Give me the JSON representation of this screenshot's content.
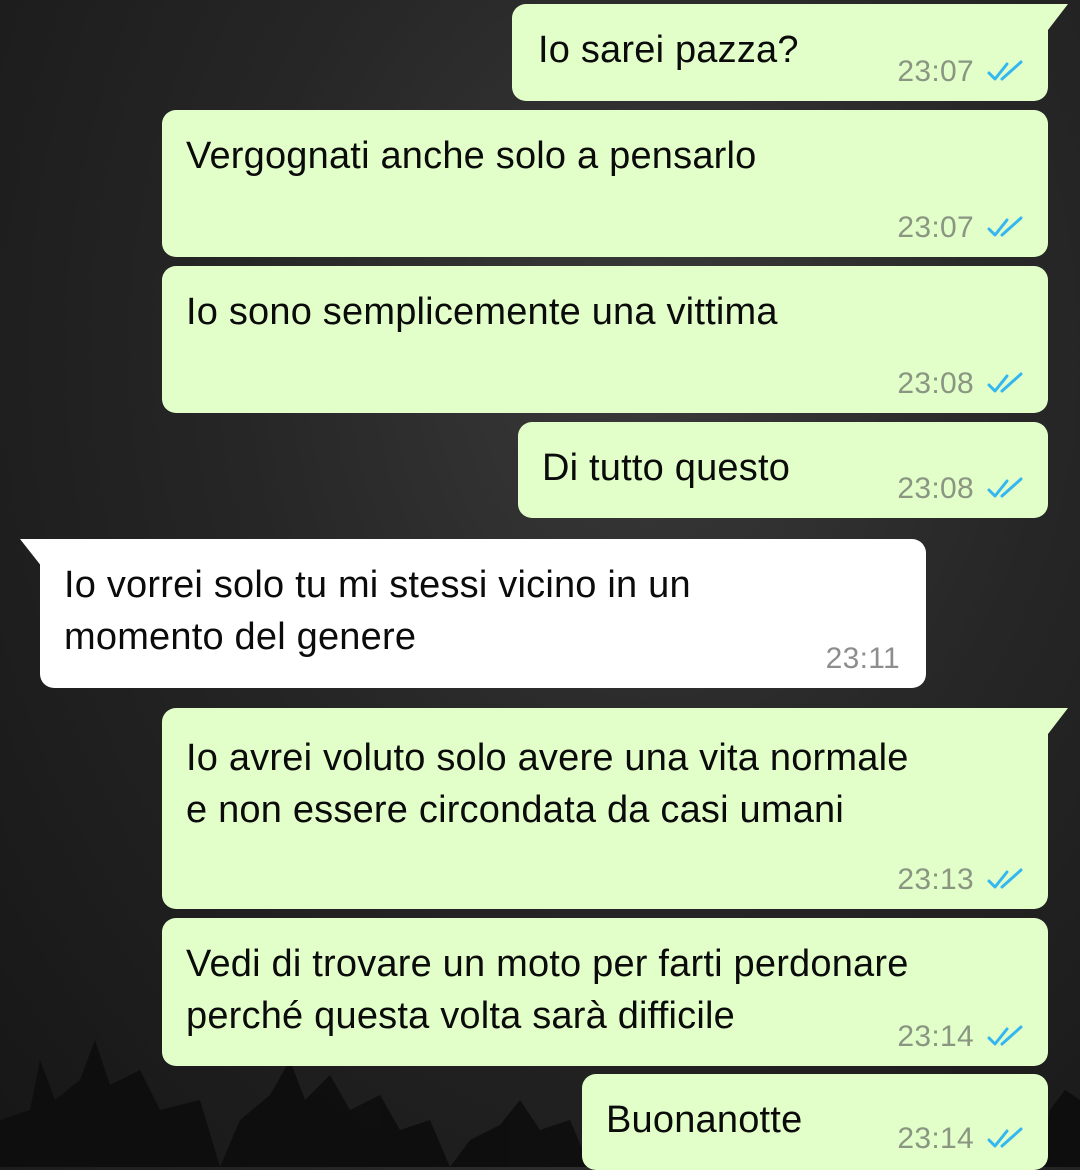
{
  "messages": [
    {
      "direction": "outgoing",
      "lines": [
        "Io sarei pazza?"
      ],
      "time": "23:07",
      "status": "read"
    },
    {
      "direction": "outgoing",
      "lines": [
        "Vergognati anche solo a pensarlo"
      ],
      "time": "23:07",
      "status": "read"
    },
    {
      "direction": "outgoing",
      "lines": [
        "Io sono semplicemente una vittima"
      ],
      "time": "23:08",
      "status": "read"
    },
    {
      "direction": "outgoing",
      "lines": [
        "Di tutto questo"
      ],
      "time": "23:08",
      "status": "read"
    },
    {
      "direction": "incoming",
      "lines": [
        "Io vorrei solo tu mi stessi vicino in un",
        "momento del genere"
      ],
      "time": "23:11"
    },
    {
      "direction": "outgoing",
      "lines": [
        "Io avrei voluto solo avere una vita normale",
        "e non essere circondata da casi umani"
      ],
      "time": "23:13",
      "status": "read"
    },
    {
      "direction": "outgoing",
      "lines": [
        "Vedi di trovare un moto per farti perdonare",
        "perché questa volta sarà difficile"
      ],
      "time": "23:14",
      "status": "read"
    },
    {
      "direction": "outgoing",
      "lines": [
        "Buonanotte"
      ],
      "time": "23:14",
      "status": "read"
    }
  ],
  "colors": {
    "outgoing_bubble": "#e2ffc9",
    "incoming_bubble": "#ffffff",
    "read_ticks": "#34b7f1",
    "wallpaper": "#262626"
  },
  "icons": {
    "read_status": "double-check-icon"
  }
}
